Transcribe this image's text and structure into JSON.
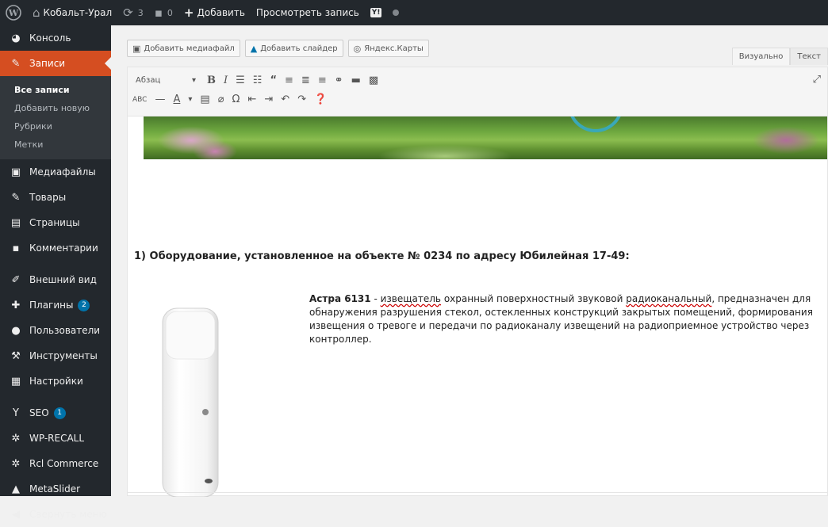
{
  "adminbar": {
    "site_name": "Кобальт-Урал",
    "updates_count": "3",
    "comments_count": "0",
    "add_label": "Добавить",
    "view_post_label": "Просмотреть запись",
    "seo_label": "Y!"
  },
  "sidebar": {
    "items": [
      {
        "label": "Консоль",
        "icon": "dashboard-icon"
      },
      {
        "label": "Записи",
        "icon": "pin-icon"
      },
      {
        "label": "Медиафайлы",
        "icon": "media-icon"
      },
      {
        "label": "Товары",
        "icon": "pin-icon"
      },
      {
        "label": "Страницы",
        "icon": "pages-icon"
      },
      {
        "label": "Комментарии",
        "icon": "comment-icon"
      },
      {
        "label": "Внешний вид",
        "icon": "brush-icon"
      },
      {
        "label": "Плагины",
        "icon": "plugin-icon",
        "badge": "2"
      },
      {
        "label": "Пользователи",
        "icon": "users-icon"
      },
      {
        "label": "Инструменты",
        "icon": "wrench-icon"
      },
      {
        "label": "Настройки",
        "icon": "settings-icon"
      },
      {
        "label": "SEO",
        "icon": "seo-icon",
        "badge": "1"
      },
      {
        "label": "WP-RECALL",
        "icon": "gear-icon"
      },
      {
        "label": "Rcl Commerce",
        "icon": "gear-icon"
      },
      {
        "label": "MetaSlider",
        "icon": "mountain-icon"
      },
      {
        "label": "Свернуть меню",
        "icon": "collapse-icon"
      }
    ],
    "submenu": [
      "Все записи",
      "Добавить новую",
      "Рубрики",
      "Метки"
    ]
  },
  "media_buttons": {
    "add_media": "Добавить медиафайл",
    "add_slider": "Добавить слайдер",
    "yandex_maps": "Яндекс.Карты"
  },
  "editor_tabs": {
    "visual": "Визуально",
    "text": "Текст"
  },
  "toolbar": {
    "format_select": "Абзац"
  },
  "content": {
    "heading": "1) Оборудование, установленное на объекте № 0234 по адресу Юбилейная 17-49:",
    "product_name": "Астра 6131",
    "desc_dash": " - ",
    "desc_word1": "извещатель",
    "desc_part1": " охранный поверхностный звуковой ",
    "desc_word2": "радиоканальный",
    "desc_part2": ", предназначен для обнаружения разрушения стекол, остекленных конструкций закрытых помещений, формирования извещения о тревоге и передачи по радиоканалу извещений на радиоприемное устройство через контроллер."
  },
  "colors": {
    "adminbar_bg": "#23282d",
    "active_menu": "#d54e21",
    "badge": "#0073aa"
  }
}
